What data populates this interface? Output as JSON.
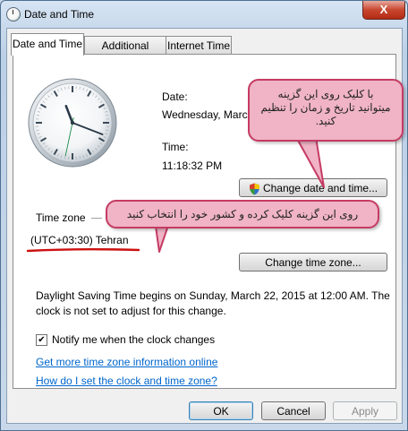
{
  "window": {
    "title": "Date and Time",
    "close_label": "X"
  },
  "tabs": [
    {
      "label": "Date and Time",
      "active": true
    },
    {
      "label": "Additional Clocks",
      "active": false
    },
    {
      "label": "Internet Time",
      "active": false
    }
  ],
  "clock": {
    "hour": 11,
    "minute": 18,
    "second": 32
  },
  "date_section": {
    "date_label": "Date:",
    "date_value": "Wednesday, March",
    "time_label": "Time:",
    "time_value": "11:18:32 PM",
    "change_button": "Change date and time..."
  },
  "timezone_section": {
    "label": "Time zone",
    "value": "(UTC+03:30) Tehran",
    "change_button": "Change time zone..."
  },
  "dst_text": {
    "line1": "Daylight Saving Time begins on Sunday, March 22, 2015 at 12:00 AM. The",
    "line2": "clock is not set to adjust for this change."
  },
  "notify": {
    "label": "Notify me when the clock changes",
    "checked": true
  },
  "links": {
    "more_info": "Get more time zone information online",
    "how_to": "How do I set the clock and time zone?"
  },
  "footer": {
    "ok": "OK",
    "cancel": "Cancel",
    "apply": "Apply"
  },
  "annotations": {
    "callout_top": {
      "line1": "با کلیک روی این گزینه",
      "line2": "میتوانید تاریخ و زمان را تنظیم",
      "line3": "کنید."
    },
    "callout_middle": "روی این گزینه کلیک کرده و کشور خود را انتخاب کنید",
    "colors": {
      "callout_fill": "#f0b4c6",
      "callout_border": "#c53b63",
      "underline": "#cc1111"
    }
  }
}
